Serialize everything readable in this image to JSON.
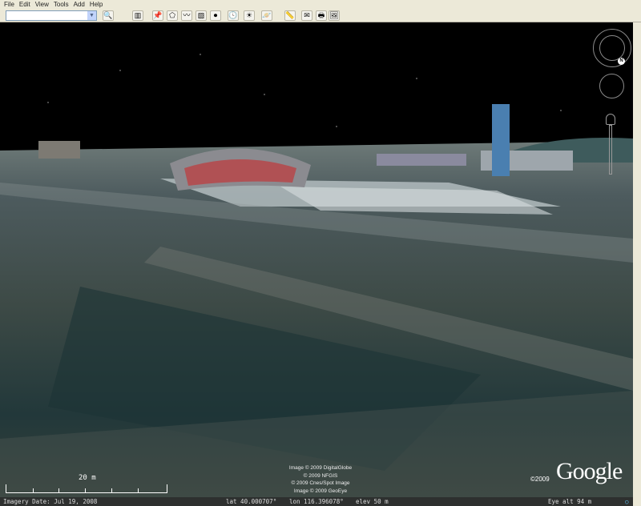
{
  "menu": [
    "File",
    "Edit",
    "View",
    "Tools",
    "Add",
    "Help"
  ],
  "search": {
    "value": "",
    "placeholder": ""
  },
  "toolbar": [
    {
      "name": "search-button",
      "glyph": "🔍"
    },
    {
      "name": "sidebar-toggle-button",
      "glyph": "▥"
    },
    {
      "name": "add-placemark-button",
      "glyph": "📌"
    },
    {
      "name": "add-polygon-button",
      "glyph": "⬠"
    },
    {
      "name": "add-path-button",
      "glyph": "〰"
    },
    {
      "name": "add-image-overlay-button",
      "glyph": "▧"
    },
    {
      "name": "record-tour-button",
      "glyph": "⏺"
    },
    {
      "name": "historical-imagery-button",
      "glyph": "🕓"
    },
    {
      "name": "sunlight-button",
      "glyph": "☀"
    },
    {
      "name": "switch-planet-button",
      "glyph": "🪐"
    },
    {
      "name": "ruler-button",
      "glyph": "📏"
    },
    {
      "name": "email-button",
      "glyph": "✉"
    },
    {
      "name": "print-button",
      "glyph": "🖶"
    },
    {
      "name": "save-image-button",
      "glyph": "🖼"
    }
  ],
  "attribution": [
    "Image © 2009 DigitalGlobe",
    "© 2009 NFGIS",
    "© 2009 Cnes/Spot Image",
    "Image © 2009 GeoEye"
  ],
  "logo": {
    "text": "Google",
    "copyright": "©2009"
  },
  "scale": {
    "label": "20 m"
  },
  "status": {
    "imagery_date": "Imagery Date: Jul 19, 2008",
    "lat": "lat   40.000707°",
    "lon": "lon  116.396078°",
    "elev": "elev   50 m",
    "eye_alt": "Eye alt      94 m"
  },
  "compass": {
    "north_label": "N"
  }
}
